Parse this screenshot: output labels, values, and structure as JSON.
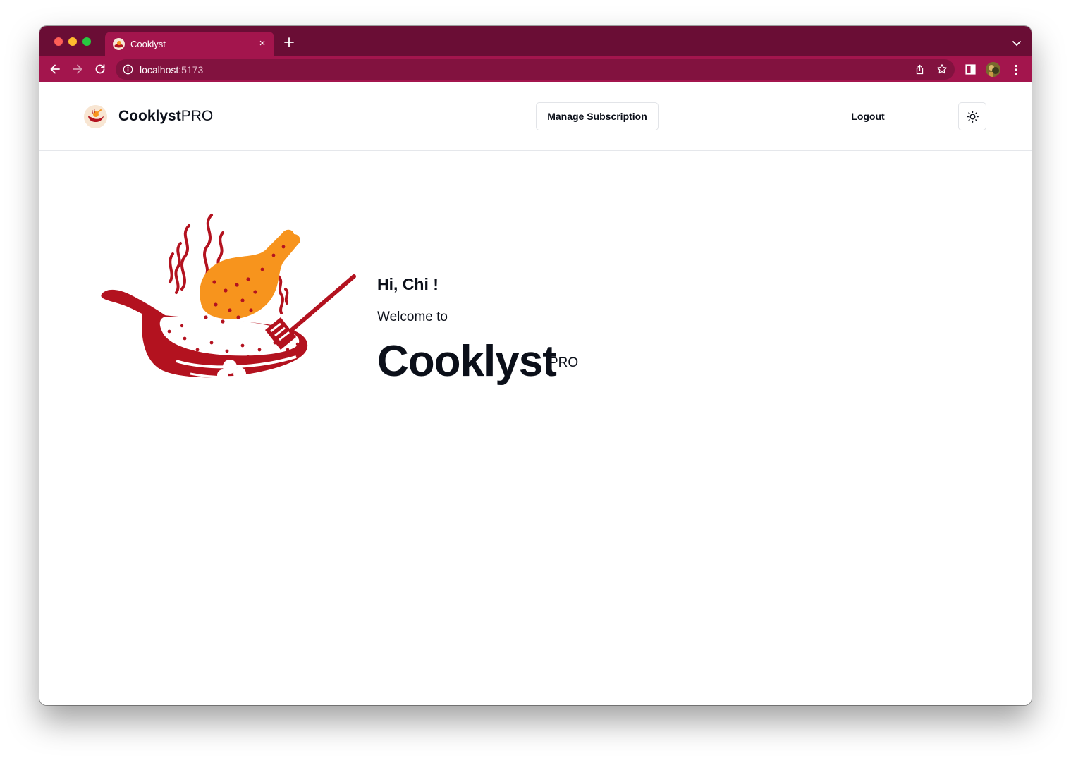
{
  "browser": {
    "tab_title": "Cooklyst",
    "tab_close": "×",
    "url_host": "localhost",
    "url_port": ":5173",
    "theme_color": "#a3154d"
  },
  "header": {
    "brand_bold": "Cooklyst",
    "brand_light": "PRO",
    "manage_subscription": "Manage Subscription",
    "logout": "Logout",
    "theme_toggle_icon": "sun-icon"
  },
  "hero": {
    "greeting": "Hi, Chi !",
    "welcome": "Welcome to",
    "app_name": "Cooklyst",
    "app_tier": "PRO",
    "accent_red": "#b3121f",
    "accent_orange": "#f7941d"
  }
}
